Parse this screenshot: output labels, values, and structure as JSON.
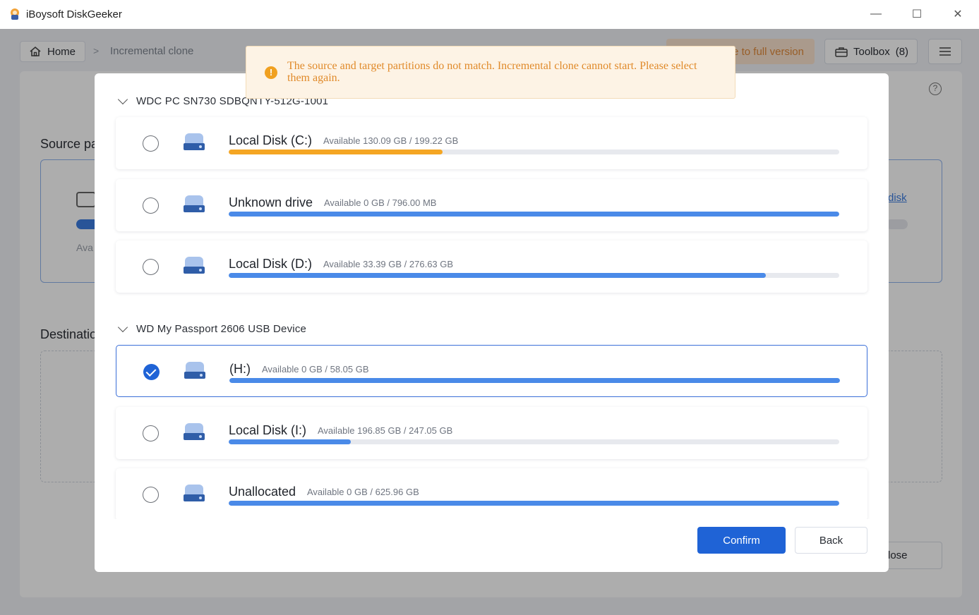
{
  "window": {
    "title": "iBoysoft DiskGeeker",
    "minimize_glyph": "—",
    "maximize_glyph": "☐",
    "close_glyph": "✕"
  },
  "toolbar": {
    "home_label": "Home",
    "breadcrumb_sep": ">",
    "breadcrumb_current": "Incremental clone",
    "upgrade_label": "e to full version",
    "toolbox_label": "Toolbox",
    "toolbox_count": "(8)"
  },
  "background": {
    "source_label": "Source pa",
    "source_available": "Ava",
    "source_link": "disk",
    "destination_label": "Destination",
    "close_label": "lose",
    "help_glyph": "?"
  },
  "toast": {
    "icon_glyph": "!",
    "message": "The source and target partitions do not match. Incremental clone cannot start. Please select them again."
  },
  "dialog": {
    "groups": [
      {
        "name": "WDC PC SN730 SDBQNTY-512G-1001",
        "partitions": [
          {
            "name": "Local Disk (C:)",
            "available": "Available 130.09 GB / 199.22 GB",
            "used_fraction": 0.35,
            "bar_color": "#f5a623",
            "selected": false
          },
          {
            "name": "Unknown drive",
            "available": "Available 0 GB / 796.00 MB",
            "used_fraction": 1.0,
            "bar_color": "#4a8ae8",
            "selected": false
          },
          {
            "name": "Local Disk (D:)",
            "available": "Available 33.39 GB / 276.63 GB",
            "used_fraction": 0.88,
            "bar_color": "#4a8ae8",
            "selected": false
          }
        ]
      },
      {
        "name": "WD My Passport 2606 USB Device",
        "partitions": [
          {
            "name": "(H:)",
            "available": "Available 0 GB / 58.05 GB",
            "used_fraction": 1.0,
            "bar_color": "#4a8ae8",
            "selected": true
          },
          {
            "name": "Local Disk (I:)",
            "available": "Available 196.85 GB / 247.05 GB",
            "used_fraction": 0.2,
            "bar_color": "#4a8ae8",
            "selected": false
          },
          {
            "name": "Unallocated",
            "available": "Available 0 GB / 625.96 GB",
            "used_fraction": 1.0,
            "bar_color": "#4a8ae8",
            "selected": false
          }
        ]
      }
    ],
    "confirm_label": "Confirm",
    "back_label": "Back"
  }
}
